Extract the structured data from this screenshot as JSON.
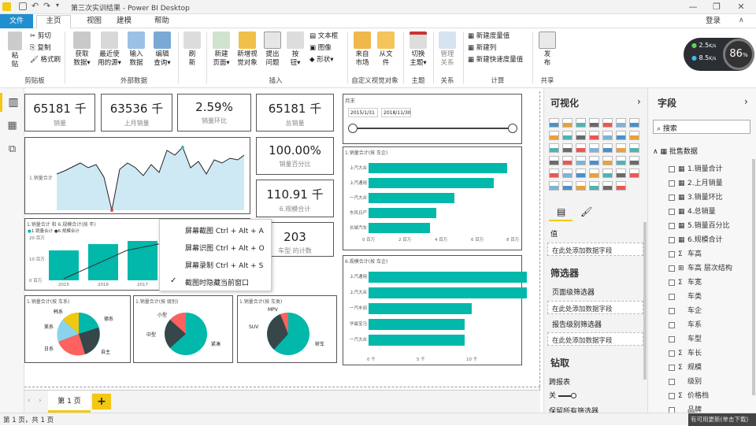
{
  "titlebar": {
    "title": "第三次实训结果 - Power BI Desktop",
    "min": "—",
    "restore": "❐",
    "close": "✕"
  },
  "menu": {
    "file": "文件",
    "tabs": [
      "主页",
      "视图",
      "建模",
      "帮助"
    ],
    "login": "登录"
  },
  "ribbon": {
    "clipboard": {
      "paste": "粘\n贴",
      "cut": "剪切",
      "copy": "复制",
      "format": "格式刷",
      "group": "剪贴板"
    },
    "external": {
      "get": "获取\n数据▾",
      "recent": "最近使\n用的源▾",
      "input": "输入\n数据",
      "edit": "编辑\n查询▾",
      "group": "外部数据"
    },
    "refresh": "刷\n新",
    "insert": {
      "newpage": "新建\n页面▾",
      "newvisual": "新增视\n觉对象",
      "ask": "提出\n问题",
      "button": "按\n钮▾",
      "textbox": "文本框",
      "image": "图像",
      "shape": "形状▾",
      "group": "插入"
    },
    "custom": {
      "market": "来自\n市场",
      "file": "从文\n件",
      "group": "自定义视觉对象"
    },
    "theme": {
      "switch": "切换\n主题▾",
      "group": "主题"
    },
    "rel": {
      "manage": "管理\n关系",
      "group": "关系"
    },
    "calc": {
      "measure": "新建度量值",
      "column": "新建列",
      "quick": "新建快速度量值",
      "group": "计算"
    },
    "share": {
      "publish": "发\n布",
      "group": "共享"
    }
  },
  "gauge": {
    "up": "2.5",
    "up_unit": "K/s",
    "down": "8.5",
    "down_unit": "K/s",
    "pct": "86",
    "pct_unit": "%"
  },
  "cards": [
    {
      "value": "65181 千",
      "label": "销量"
    },
    {
      "value": "63536 千",
      "label": "上月销量"
    },
    {
      "value": "2.59%",
      "label": "销量环比"
    },
    {
      "value": "65181 千",
      "label": "总销量"
    },
    {
      "value": "100.00%",
      "label": "销量百分比"
    },
    {
      "value": "110.91 千",
      "label": "6.规模合计"
    },
    {
      "value": "203",
      "label": "车型 的计数"
    }
  ],
  "slicer": {
    "title": "月末",
    "start": "2015/1/31",
    "end": "2018/11/30"
  },
  "charts": {
    "line": {
      "ylabel": "1.销量合计"
    },
    "combo": {
      "title": "1.销量合计 和 6.规模合计(按 年)",
      "legend1": "1.销量合计",
      "legend2": "6.规模合计",
      "ticks": [
        "20 百万",
        "10 百万",
        "0 百万"
      ],
      "years": [
        "2015",
        "2016",
        "2017"
      ]
    },
    "bar1": {
      "title": "1.销量合计(按 车企)",
      "ticks": [
        "0 百万",
        "2 百万",
        "4 百万",
        "6 百万",
        "8 百万"
      ]
    },
    "bar2": {
      "title": "6.规模合计(按 车企)",
      "ticks": [
        "0 千",
        "5 千",
        "10 千"
      ]
    },
    "pie1": {
      "title": "1.销量合计(按 车系)",
      "labels": [
        "韩系",
        "德系",
        "美系",
        "日系",
        "自主"
      ]
    },
    "pie2": {
      "title": "1.销量合计(按 级别)",
      "labels": [
        "小型",
        "中型",
        "紧凑"
      ]
    },
    "pie3": {
      "title": "1.销量合计(按 车类)",
      "labels": [
        "MPV",
        "SUV",
        "轿车"
      ]
    }
  },
  "chart_data": [
    {
      "type": "bar",
      "title": "1.销量合计(按 车企)",
      "categories": [
        "上汽大众",
        "上汽通用",
        "一汽大众",
        "东风日产",
        "长城汽车"
      ],
      "values": [
        7.4,
        6.7,
        4.6,
        3.6,
        3.3
      ],
      "xlim": [
        0,
        8
      ],
      "unit": "百万"
    },
    {
      "type": "bar",
      "title": "6.规模合计(按 车企)",
      "categories": [
        "上汽通用",
        "上汽大众",
        "一汽丰田",
        "华晨宝马",
        "一汽大众"
      ],
      "values": [
        12.7,
        12.7,
        8.3,
        7.7,
        7.7
      ],
      "xlim": [
        0,
        12
      ],
      "unit": "千"
    },
    {
      "type": "pie",
      "title": "1.销量合计(按 车系)",
      "categories": [
        "德系",
        "自主",
        "日系",
        "美系",
        "韩系"
      ],
      "values": [
        22,
        30,
        20,
        8,
        10
      ]
    },
    {
      "type": "pie",
      "title": "1.销量合计(按 级别)",
      "categories": [
        "紧凑",
        "中型",
        "小型"
      ],
      "values": [
        70,
        20,
        10
      ]
    },
    {
      "type": "pie",
      "title": "1.销量合计(按 车类)",
      "categories": [
        "轿车",
        "SUV",
        "MPV"
      ],
      "values": [
        60,
        35,
        5
      ]
    }
  ],
  "context_menu": [
    "屏幕截图 Ctrl + Alt + A",
    "屏幕识图 Ctrl + Alt + O",
    "屏幕录制 Ctrl + Alt + S",
    "截图时隐藏当前窗口"
  ],
  "pages": {
    "tab": "第 1 页",
    "add": "+"
  },
  "status": {
    "left": "第 1 页，共 1 页",
    "right": "有可用更新(单击下载)"
  },
  "viz": {
    "title": "可视化",
    "values": "值",
    "add_field": "在此处添加数据字段",
    "filters": "筛选器",
    "page_filter": "页面级筛选器",
    "add_field2": "在此处添加数据字段",
    "report_filter": "报告级别筛选器",
    "add_field3": "在此处添加数据字段",
    "drill": "钻取",
    "cross": "跨报表",
    "off": "关",
    "keep": "保留所有筛选器"
  },
  "fields": {
    "title": "字段",
    "search": "搜索",
    "table": "批售数据",
    "items": [
      "1.销量合计",
      "2.上月销量",
      "3.销量环比",
      "4.总销量",
      "5.销量百分比",
      "6.规模合计",
      "车高",
      "车高 层次结构",
      "车宽",
      "车类",
      "车企",
      "车系",
      "车型",
      "车长",
      "规模",
      "级别",
      "价格档",
      "品牌"
    ]
  }
}
